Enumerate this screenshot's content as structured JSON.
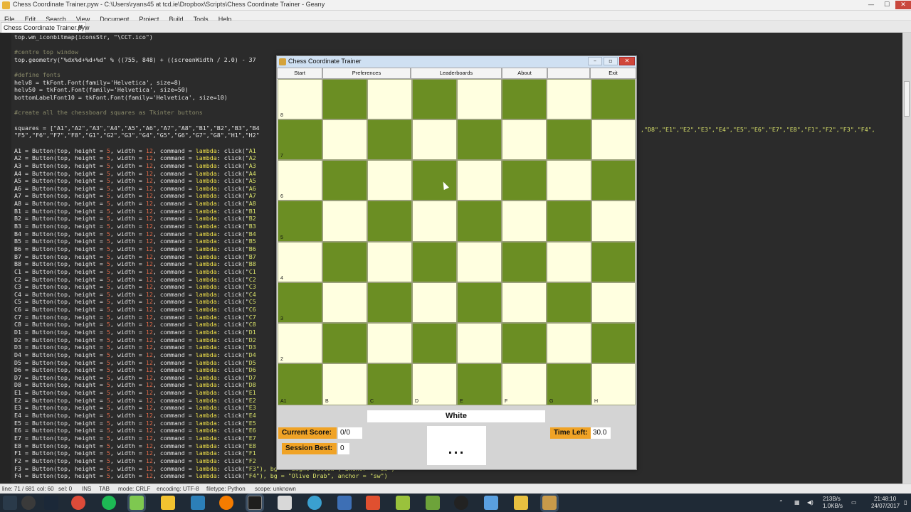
{
  "geany": {
    "title": "Chess Coordinate Trainer.pyw - C:\\Users\\ryans45 at tcd.ie\\Dropbox\\Scripts\\Chess Coordinate Trainer - Geany",
    "menu": [
      "File",
      "Edit",
      "Search",
      "View",
      "Document",
      "Project",
      "Build",
      "Tools",
      "Help"
    ],
    "tab_label": "Chess Coordinate Trainer.pyw",
    "window_controls": {
      "minimize": "—",
      "maximize": "☐",
      "close": "✕"
    }
  },
  "code_lines": [
    "top.wm_iconbitmap(iconsStr, \"\\CCT.ico\")",
    "",
    "#centre top window",
    "top.geometry(\"%dx%d+%d+%d\" % ((755, 848) + ((screenWidth / 2.0) - 37",
    "",
    "#define fonts",
    "helv8 = tkFont.Font(family='Helvetica', size=8)",
    "helv50 = tkFont.Font(family='Helvetica', size=50)",
    "bottomLabelFont10 = tkFont.Font(family='Helvetica', size=10)",
    "",
    "#create all the chessboard squares as Tkinter buttons",
    "",
    "squares = [\"A1\",\"A2\",\"A3\",\"A4\",\"A5\",\"A6\",\"A7\",\"A8\",\"B1\",\"B2\",\"B3\",\"B4",
    "\"F5\",\"F6\",\"F7\",\"F8\",\"G1\",\"G2\",\"G3\",\"G4\",\"G5\",\"G6\",\"G7\",\"G8\",\"H1\",\"H2\"",
    ""
  ],
  "squares_right_text": ",\"D8\",\"E1\",\"E2\",\"E3\",\"E4\",\"E5\",\"E6\",\"E7\",\"E8\",\"F1\",\"F2\",\"F3\",\"F4\",",
  "button_lines": [
    "A1",
    "A2",
    "A3",
    "A4",
    "A5",
    "A6",
    "A7",
    "A8",
    "B1",
    "B2",
    "B3",
    "B4",
    "B5",
    "B6",
    "B7",
    "B8",
    "C1",
    "C2",
    "C3",
    "C4",
    "C5",
    "C6",
    "C7",
    "C8",
    "D1",
    "D2",
    "D3",
    "D4",
    "D5",
    "D6",
    "D7",
    "D8",
    "E1",
    "E2",
    "E3",
    "E4",
    "E5",
    "E6",
    "E7",
    "E8",
    "F1",
    "F2",
    "F3",
    "F4"
  ],
  "button_line_prefix": " = Button(top, height = ",
  "button_line_height": "5",
  "button_line_mid": ", width = ",
  "button_line_width": "12",
  "button_line_cmd": ", command = ",
  "button_line_lambda": "lambda",
  "button_line_click": ": click(\"",
  "button_line_tail_f3": "\"), bg = \"Light Yellow\", anchor = \"sw\")",
  "button_line_tail_f4": "\"), bg = \"Olive Drab\", anchor = \"sw\")",
  "statusbar": {
    "line": "line: 71 / 681",
    "col": "col: 60",
    "sel": "sel: 0",
    "ins": "INS",
    "tab": "TAB",
    "mode": "mode: CRLF",
    "encoding": "encoding: UTF-8",
    "filetype": "filetype: Python",
    "scope": "scope: unknown"
  },
  "tray": {
    "net_up": "213B/s",
    "net_down": "1.0KB/s",
    "time": "21:48:10",
    "date": "24/07/2017"
  },
  "cct": {
    "title": "Chess Coordinate Trainer",
    "menu_buttons": [
      "Start",
      "Preferences",
      "Leaderboards",
      "About",
      "",
      "Exit"
    ],
    "rank_labels": [
      "8",
      "7",
      "6",
      "5",
      "4",
      "3",
      "2",
      "1"
    ],
    "file_labels": [
      "A",
      "B",
      "C",
      "D",
      "E",
      "F",
      "G",
      "H"
    ],
    "corner_label": "A1",
    "turn": "White",
    "current_score_label": "Current Score:",
    "current_score": "0/0",
    "session_best_label": "Session Best:",
    "session_best": "0",
    "time_left_label": "Time Left:",
    "time_left": "30.0",
    "target_square": "...",
    "colors": {
      "dark": "#6b8e23",
      "light": "#ffffe0",
      "accent": "#f0a326"
    }
  }
}
